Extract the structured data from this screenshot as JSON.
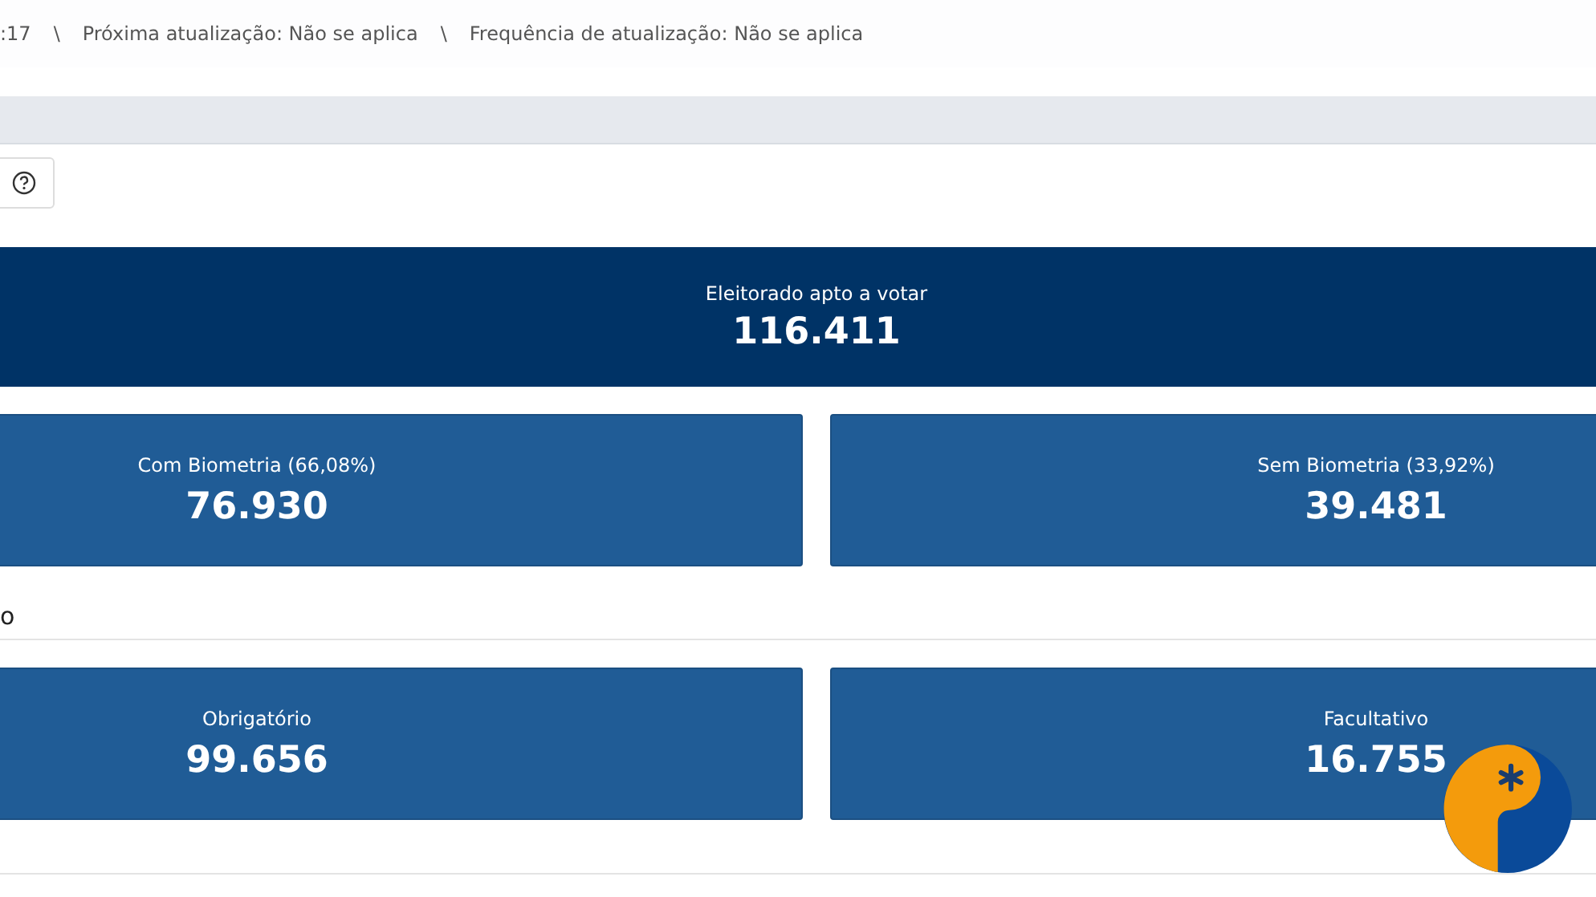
{
  "breadcrumb": [
    ":17",
    "Próxima atualização: Não se aplica",
    "Frequência de atualização: Não se aplica"
  ],
  "breadcrumb_separator": "\\",
  "total": {
    "label": "Eleitorado apto a votar",
    "value": "116.411"
  },
  "biometry_cards": [
    {
      "label": "Com Biometria (66,08%)",
      "value": "76.930"
    },
    {
      "label": "Sem Biometria (33,92%)",
      "value": "39.481"
    }
  ],
  "section_title": "o",
  "obligation_cards": [
    {
      "label": "Obrigatório",
      "value": "99.656"
    },
    {
      "label": "Facultativo",
      "value": "16.755"
    }
  ]
}
